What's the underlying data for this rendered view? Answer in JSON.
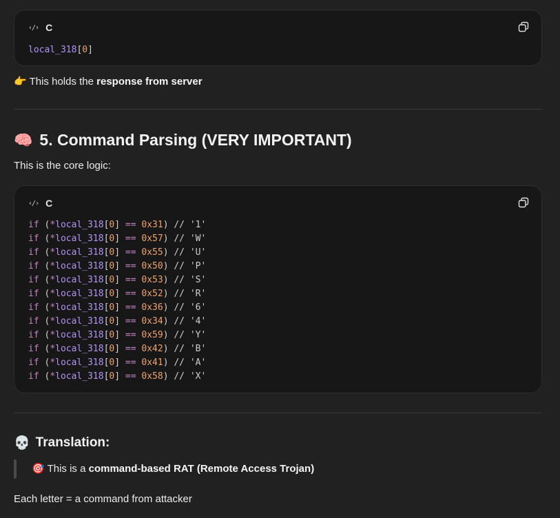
{
  "block1": {
    "lang": "C",
    "code": {
      "id": "local_318",
      "bracket_open": "[",
      "index": "0",
      "bracket_close": "]"
    }
  },
  "note1": {
    "prefix": "This holds the ",
    "bold": "response from server"
  },
  "section5": {
    "title": "5. Command Parsing (VERY IMPORTANT)",
    "intro": "This is the core logic:"
  },
  "block2": {
    "lang": "C",
    "lines": [
      {
        "hex": "0x31",
        "ch": "'1'"
      },
      {
        "hex": "0x57",
        "ch": "'W'"
      },
      {
        "hex": "0x55",
        "ch": "'U'"
      },
      {
        "hex": "0x50",
        "ch": "'P'"
      },
      {
        "hex": "0x53",
        "ch": "'S'"
      },
      {
        "hex": "0x52",
        "ch": "'R'"
      },
      {
        "hex": "0x36",
        "ch": "'6'"
      },
      {
        "hex": "0x34",
        "ch": "'4'"
      },
      {
        "hex": "0x59",
        "ch": "'Y'"
      },
      {
        "hex": "0x42",
        "ch": "'B'"
      },
      {
        "hex": "0x41",
        "ch": "'A'"
      },
      {
        "hex": "0x58",
        "ch": "'X'"
      }
    ],
    "tokens": {
      "kw": "if",
      "open": " (",
      "deref": "*",
      "id": "local_318",
      "bo": "[",
      "idx": "0",
      "bc": "]",
      "eq": " == ",
      "close": ") ",
      "comment": "// "
    }
  },
  "translation": {
    "title": "Translation:",
    "quote_prefix": "This is a ",
    "quote_bold": "command-based RAT (Remote Access Trojan)",
    "closing": "Each letter = a command from attacker"
  },
  "icons": {
    "code": "code-brackets-icon",
    "copy": "copy-icon",
    "point": "pointing-hand-icon",
    "brain": "brain-icon",
    "skull": "skull-icon",
    "target": "target-icon"
  },
  "colors": {
    "background": "#212121",
    "code_bg": "#171717",
    "keyword": "#c586c0",
    "identifier": "#b294f5",
    "number": "#f0a36e"
  }
}
